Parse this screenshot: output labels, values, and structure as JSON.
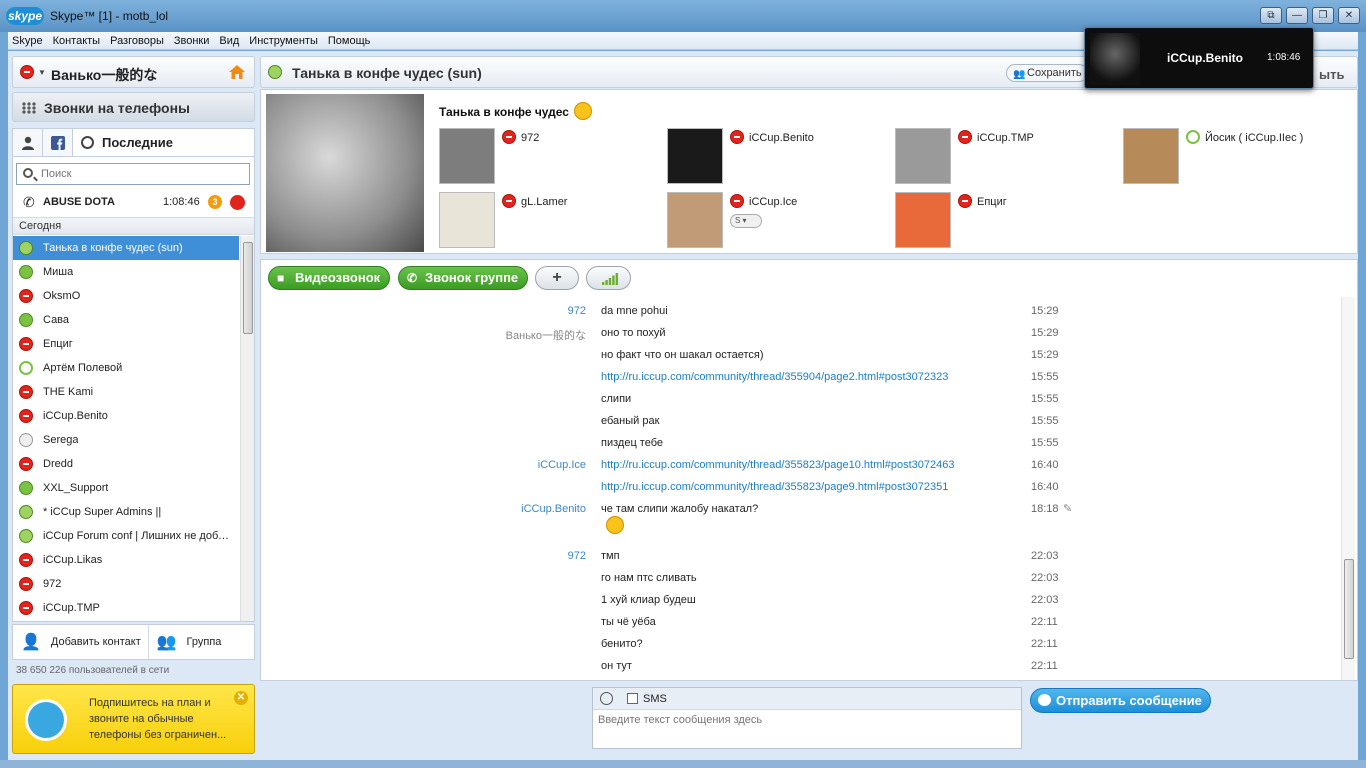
{
  "window": {
    "logo": "skype",
    "title": "Skype™ [1] - motb_lol",
    "buttons": [
      "⧉",
      "—",
      "❐",
      "✕"
    ]
  },
  "menu": [
    "Skype",
    "Контакты",
    "Разговоры",
    "Звонки",
    "Вид",
    "Инструменты",
    "Помощь"
  ],
  "profile": {
    "name": "Ванько一般的な",
    "status": "busy"
  },
  "phones_label": "Звонки на телефоны",
  "tabs": {
    "recent_label": "Последние"
  },
  "search": {
    "placeholder": "Поиск"
  },
  "active_call": {
    "name": "ABUSE DOTA",
    "time": "1:08:46",
    "badge": "3"
  },
  "section_today": "Сегодня",
  "contacts": [
    {
      "name": "Танька в конфе чудес (sun)",
      "status": "group",
      "selected": true
    },
    {
      "name": "Миша",
      "status": "online"
    },
    {
      "name": "OksmO",
      "status": "busy"
    },
    {
      "name": "Сава",
      "status": "online"
    },
    {
      "name": "Епциг",
      "status": "busy"
    },
    {
      "name": "Артём Полевой",
      "status": "outline"
    },
    {
      "name": "THE Kami",
      "status": "busy"
    },
    {
      "name": "iCCup.Benito",
      "status": "busy"
    },
    {
      "name": "Serega",
      "status": "unknown"
    },
    {
      "name": "Dredd",
      "status": "busy"
    },
    {
      "name": "XXL_Support",
      "status": "online"
    },
    {
      "name": "* iCCup Super Admins ||",
      "status": "group"
    },
    {
      "name": "iCCup Forum conf | Лишних не доба...",
      "status": "group"
    },
    {
      "name": "iCCup.Likas",
      "status": "busy"
    },
    {
      "name": "972",
      "status": "busy"
    },
    {
      "name": "iCCup.TMP",
      "status": "busy"
    }
  ],
  "actions": {
    "add_contact": "Добавить контакт",
    "group": "Группа"
  },
  "online_count": "38 650 226 пользователей в сети",
  "promo": {
    "text": "Подпишитесь на план и звоните на обычные телефоны без ограничен...",
    "close": "✕"
  },
  "conversation": {
    "title": "Танька в конфе чудес (sun)",
    "save_label": "Сохранить",
    "close_label": "ыть",
    "group_title": "Танька в конфе чудес",
    "participants": [
      {
        "name": "972",
        "status": "busy"
      },
      {
        "name": "iCCup.Benito",
        "status": "busy"
      },
      {
        "name": "iCCup.TMP",
        "status": "busy"
      },
      {
        "name": "Йосик ( iCCup.IIec )",
        "status": "outline"
      },
      {
        "name": "gL.Lamer",
        "status": "busy"
      },
      {
        "name": "iCCup.Ice",
        "status": "busy"
      },
      {
        "name": "Епциг",
        "status": "busy"
      }
    ],
    "skype_pill": "S ▾"
  },
  "toolbar": {
    "video_call": "Видеозвонок",
    "group_call": "Звонок группе",
    "add": "+"
  },
  "messages": [
    {
      "who": "972",
      "text": "da mne pohui",
      "time": "15:29"
    },
    {
      "who": "Ванько一般的な",
      "self": true,
      "text": "оно то похуй",
      "time": "15:29"
    },
    {
      "who": "",
      "text": "но факт что он шакал остается)",
      "time": "15:29"
    },
    {
      "who": "",
      "text": "http://ru.iccup.com/community/thread/355904/page2.html#post3072323",
      "link": true,
      "time": "15:55"
    },
    {
      "who": "",
      "text": "слипи",
      "time": "15:55"
    },
    {
      "who": "",
      "text": "ебаный рак",
      "time": "15:55"
    },
    {
      "who": "",
      "text": "пиздец тебе",
      "time": "15:55"
    },
    {
      "who": "iCCup.Ice",
      "text": "http://ru.iccup.com/community/thread/355823/page10.html#post3072463",
      "link": true,
      "time": "16:40"
    },
    {
      "who": "",
      "text": "http://ru.iccup.com/community/thread/355823/page9.html#post3072351",
      "link": true,
      "time": "16:40"
    },
    {
      "who": "iCCup.Benito",
      "text": "че там слипи жалобу накатал?",
      "time": "18:18",
      "edited": true
    },
    {
      "who": "972",
      "text": "тмп",
      "time": "22:03"
    },
    {
      "who": "",
      "text": "го нам птс сливать",
      "time": "22:03"
    },
    {
      "who": "",
      "text": "1 хуй клиар будеш",
      "time": "22:03"
    },
    {
      "who": "",
      "text": "ты чё уёба",
      "time": "22:11"
    },
    {
      "who": "",
      "text": "бенито?",
      "time": "22:11"
    },
    {
      "who": "",
      "text": "он тут",
      "time": "22:11"
    }
  ],
  "compose": {
    "sms_label": "SMS",
    "placeholder": "Введите текст сообщения здесь"
  },
  "send_label": "Отправить сообщение",
  "call_overlay": {
    "name": "iCCup.Benito",
    "time": "1:08:46"
  }
}
